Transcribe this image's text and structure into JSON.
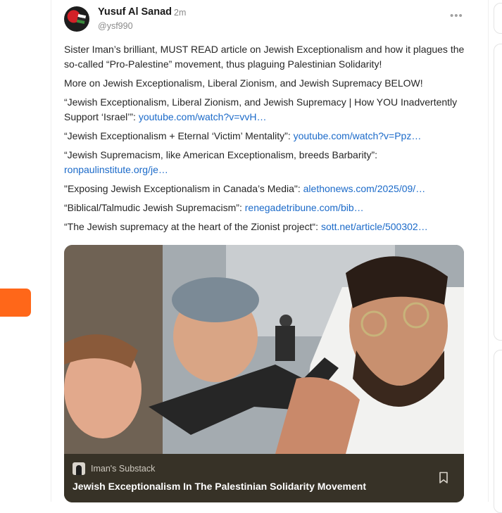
{
  "author": {
    "name": "Yusuf Al Sanad",
    "time": "2m",
    "handle": "@ysf990"
  },
  "more_icon": "more-horizontal-icon",
  "post": {
    "p1": "Sister Iman’s brilliant, MUST READ article on Jewish Exceptionalism and how it plagues the so-called “Pro-Palestine” movement, thus plaguing Palestinian Solidarity!",
    "p2": "More on Jewish Exceptionalism, Liberal Zionism, and Jewish Supremacy BELOW!",
    "links": [
      {
        "text": "“Jewish Exceptionalism, Liberal Zionism, and Jewish Supremacy | How YOU Inadvertently Support ‘Israel’”: ",
        "url": "youtube.com/watch?v=vvH…"
      },
      {
        "text": "“Jewish Exceptionalism + Eternal ‘Victim’ Mentality”: ",
        "url": "youtube.com/watch?v=Ppz…"
      },
      {
        "text": "“Jewish Supremacism, like American Exceptionalism, breeds Barbarity”: ",
        "url": "ronpaulinstitute.org/je…"
      },
      {
        "text": "\"Exposing Jewish Exceptionalism in Canada’s Media\": ",
        "url": "alethonews.com/2025/09/…"
      },
      {
        "text": "“Biblical/Talmudic Jewish Supremacism”: ",
        "url": "renegadetribune.com/bib…"
      },
      {
        "text": "“The Jewish supremacy at the heart of the Zionist project“: ",
        "url": "sott.net/article/500302…"
      }
    ]
  },
  "embed": {
    "publication": "Iman's Substack",
    "title": "Jewish Exceptionalism In The Palestinian Solidarity Movement",
    "bookmark_icon": "bookmark-icon"
  },
  "colors": {
    "link": "#1b6ac9",
    "accent": "#ff6719",
    "embed_footer": "#373227"
  }
}
